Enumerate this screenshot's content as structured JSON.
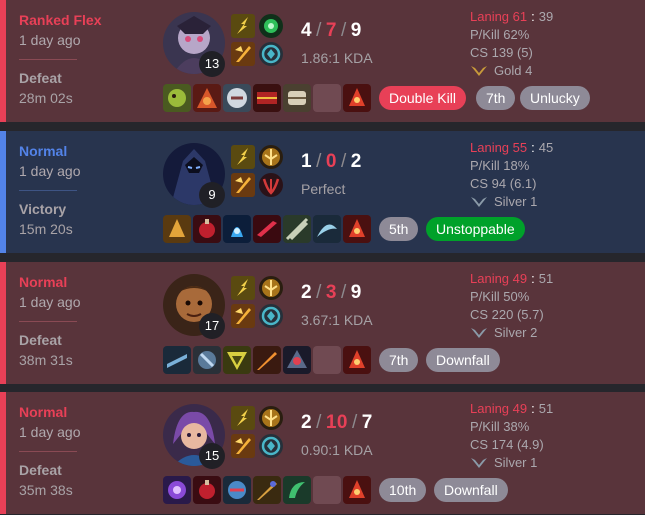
{
  "matches": [
    {
      "queue": "Ranked Flex",
      "time_ago": "1 day ago",
      "result": "Defeat",
      "duration": "28m 02s",
      "champion_level": "13",
      "kills": "4",
      "deaths": "7",
      "assists": "9",
      "kda_ratio": "1.86:1 KDA",
      "badges": [
        "Double Kill",
        "7th",
        "Unlucky"
      ],
      "laning_label": "Laning 61",
      "laning_opp": "39",
      "pkill": "P/Kill 62%",
      "cs": "CS 139 (5)",
      "rank": "Gold 4",
      "rank_icon": "gold-emblem-icon"
    },
    {
      "queue": "Normal",
      "time_ago": "1 day ago",
      "result": "Victory",
      "duration": "15m 20s",
      "champion_level": "9",
      "kills": "1",
      "deaths": "0",
      "assists": "2",
      "kda_ratio": "Perfect",
      "badges": [
        "5th",
        "Unstoppable"
      ],
      "laning_label": "Laning 55",
      "laning_opp": "45",
      "pkill": "P/Kill 18%",
      "cs": "CS 94 (6.1)",
      "rank": "Silver 1",
      "rank_icon": "silver-emblem-icon"
    },
    {
      "queue": "Normal",
      "time_ago": "1 day ago",
      "result": "Defeat",
      "duration": "38m 31s",
      "champion_level": "17",
      "kills": "2",
      "deaths": "3",
      "assists": "9",
      "kda_ratio": "3.67:1 KDA",
      "badges": [
        "7th",
        "Downfall"
      ],
      "laning_label": "Laning 49",
      "laning_opp": "51",
      "pkill": "P/Kill 50%",
      "cs": "CS 220 (5.7)",
      "rank": "Silver 2",
      "rank_icon": "silver-emblem-icon"
    },
    {
      "queue": "Normal",
      "time_ago": "1 day ago",
      "result": "Defeat",
      "duration": "35m 38s",
      "champion_level": "15",
      "kills": "2",
      "deaths": "10",
      "assists": "7",
      "kda_ratio": "0.90:1 KDA",
      "badges": [
        "10th",
        "Downfall"
      ],
      "laning_label": "Laning 49",
      "laning_opp": "51",
      "pkill": "P/Kill 38%",
      "cs": "CS 174 (4.9)",
      "rank": "Silver 1",
      "rank_icon": "silver-emblem-icon"
    }
  ],
  "colors": {
    "loss_bg": "#59343b",
    "win_bg": "#28344e",
    "loss_accent": "#e84057",
    "win_accent": "#5383e8",
    "good_badge": "#00a12a"
  }
}
